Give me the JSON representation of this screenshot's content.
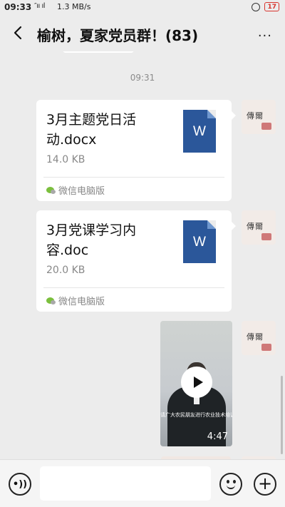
{
  "status_bar": {
    "time": "09:33",
    "signal": "″ıı ıl",
    "network_speed": "1.3 MB/s",
    "battery": "17"
  },
  "header": {
    "back_icon": "chevron-left-icon",
    "title": "榆树，夏家党员群！(83)",
    "more_icon": "more-horizontal-icon",
    "more_label": "···"
  },
  "chat": {
    "timestamp": "09:31",
    "messages": [
      {
        "type": "file",
        "file_name": "3月主题党日活动.docx",
        "file_size": "14.0 KB",
        "file_icon": "word-doc-icon",
        "file_icon_label": "W",
        "source": "微信电脑版"
      },
      {
        "type": "file",
        "file_name": "3月党课学习内容.doc",
        "file_size": "20.0 KB",
        "file_icon": "word-doc-icon",
        "file_icon_label": "W",
        "source": "微信电脑版"
      },
      {
        "type": "video",
        "duration": "4:47",
        "subtitle": "请广大农民朋友进行农业技术培训"
      }
    ],
    "avatar_glyph": "傳爾"
  },
  "input_bar": {
    "voice_icon": "voice-icon",
    "voice_label": "•))",
    "input_placeholder": "",
    "emoji_icon": "emoji-icon",
    "plus_icon": "plus-icon",
    "plus_label": "+"
  },
  "colors": {
    "background": "#ececec",
    "bubble": "#ffffff",
    "word_blue": "#2b579a",
    "battery_red": "#d8352e"
  }
}
